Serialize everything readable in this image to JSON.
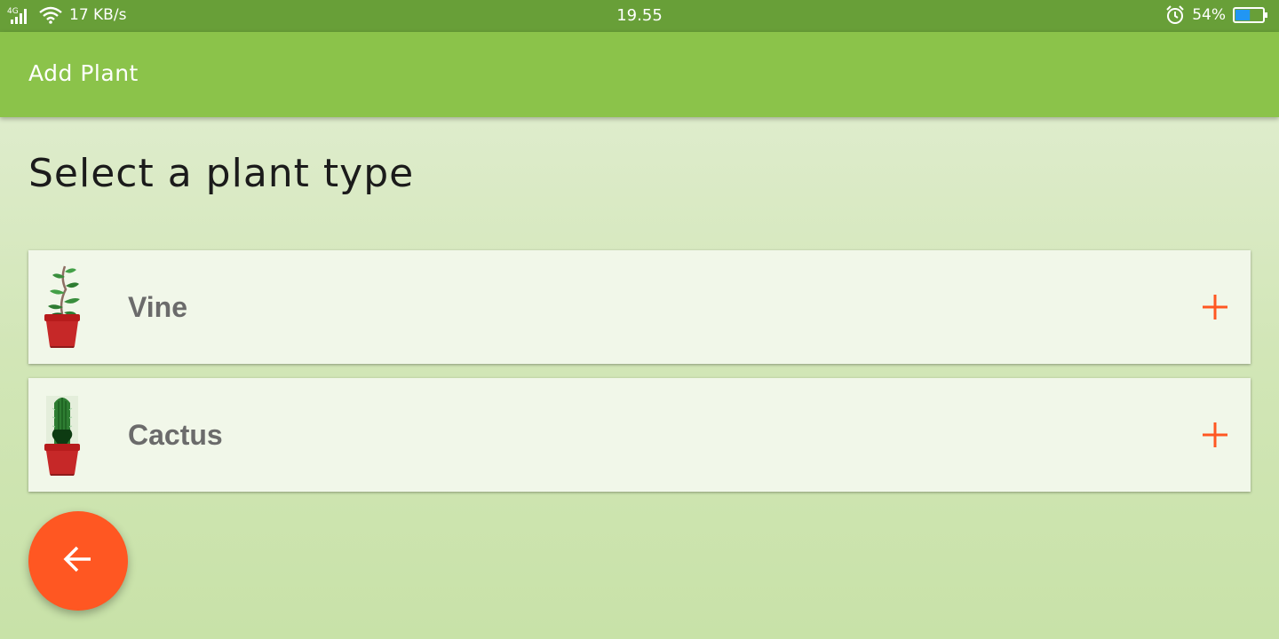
{
  "status_bar": {
    "network_type": "4G",
    "net_speed": "17 KB/s",
    "time": "19.55",
    "battery": "54%",
    "battery_level": 0.54,
    "icons": [
      "signal-icon",
      "wifi-icon",
      "alarm-icon",
      "battery-icon"
    ]
  },
  "app_bar": {
    "title": "Add Plant"
  },
  "main": {
    "heading": "Select a plant type",
    "plants": [
      {
        "label": "Vine",
        "icon": "vine-plant-icon",
        "action_icon": "plus-icon"
      },
      {
        "label": "Cactus",
        "icon": "cactus-plant-icon",
        "action_icon": "plus-icon"
      }
    ]
  },
  "fab": {
    "icon": "arrow-back-icon"
  },
  "colors": {
    "status_bar": "#689f38",
    "app_bar": "#8bc34a",
    "accent": "#ff5722",
    "card": "#f1f7e9",
    "label_text": "#6b6b6b"
  }
}
